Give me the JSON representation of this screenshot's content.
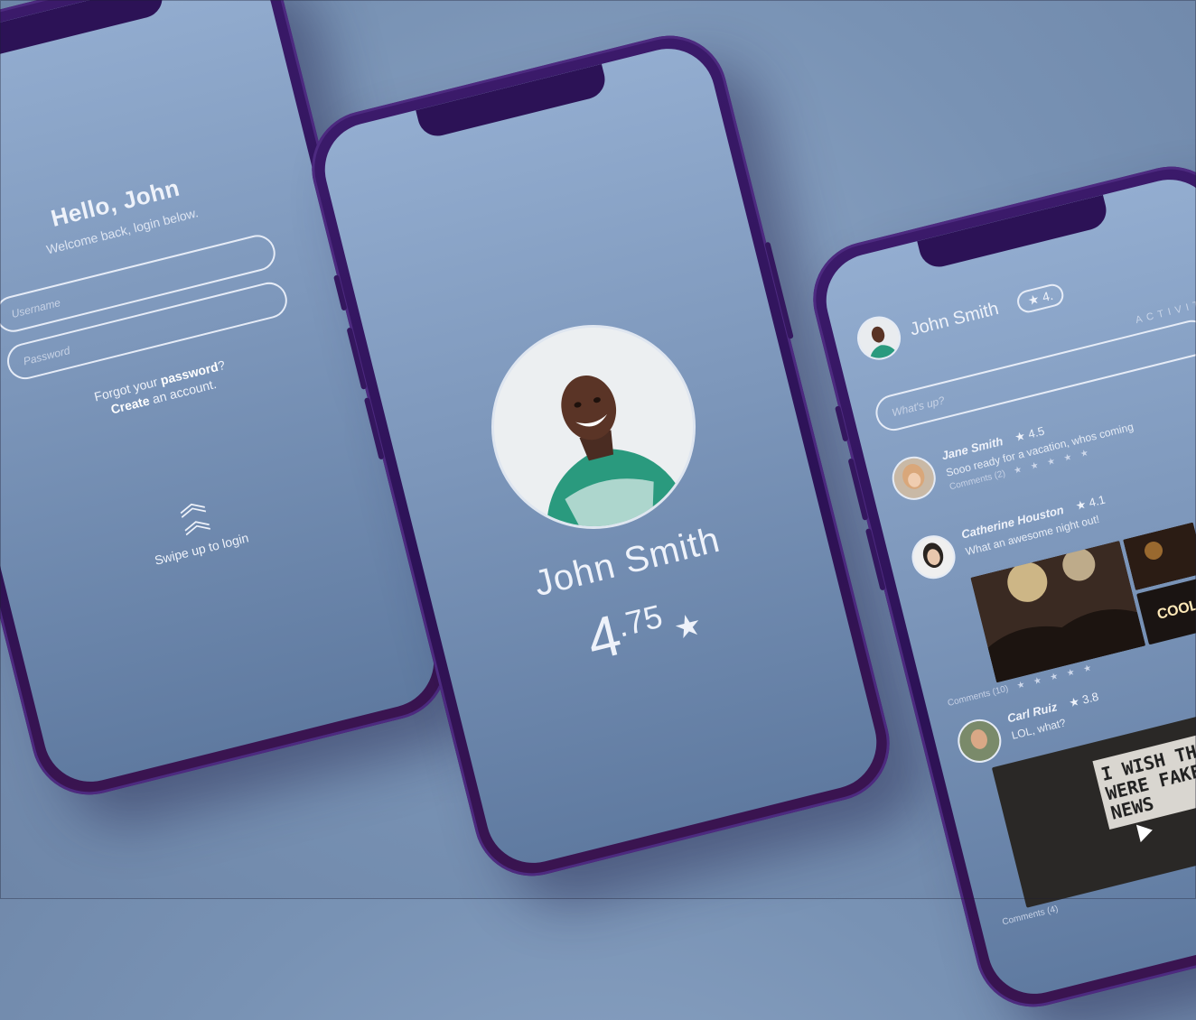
{
  "login": {
    "greeting": "Hello, John",
    "subtitle": "Welcome back, login below.",
    "username_placeholder": "Username",
    "password_placeholder": "Password",
    "forgot_prefix": "Forgot your ",
    "forgot_link": "password",
    "forgot_suffix": "?",
    "create_link": "Create",
    "create_suffix": " an account.",
    "swipe_label": "Swipe up to login"
  },
  "profile": {
    "name": "John Smith",
    "rating_int": "4",
    "rating_dec": ".75",
    "star": "★"
  },
  "feed": {
    "user_name": "John Smith",
    "user_rating": "★ 4.",
    "activity_label": "ACTIVITY",
    "whats_up_placeholder": "What's up?",
    "posts": [
      {
        "name": "Jane Smith",
        "rating": "★ 4.5",
        "text": "Sooo ready for a vacation, whos coming",
        "comments": "Comments (2)",
        "stars": "★★★★★"
      },
      {
        "name": "Catherine Houston",
        "rating": "★ 4.1",
        "text": "What an awesome night out!",
        "comments": "Comments (10)",
        "stars": "★★★★★"
      },
      {
        "name": "Carl Ruiz",
        "rating": "★ 3.8",
        "text": "LOL, what?",
        "comments": "Comments (4)",
        "stars": "",
        "sign_text": "I WISH THIS WERE FAKE NEWS"
      }
    ]
  },
  "photo_text": {
    "cool_sign": "COOL"
  }
}
